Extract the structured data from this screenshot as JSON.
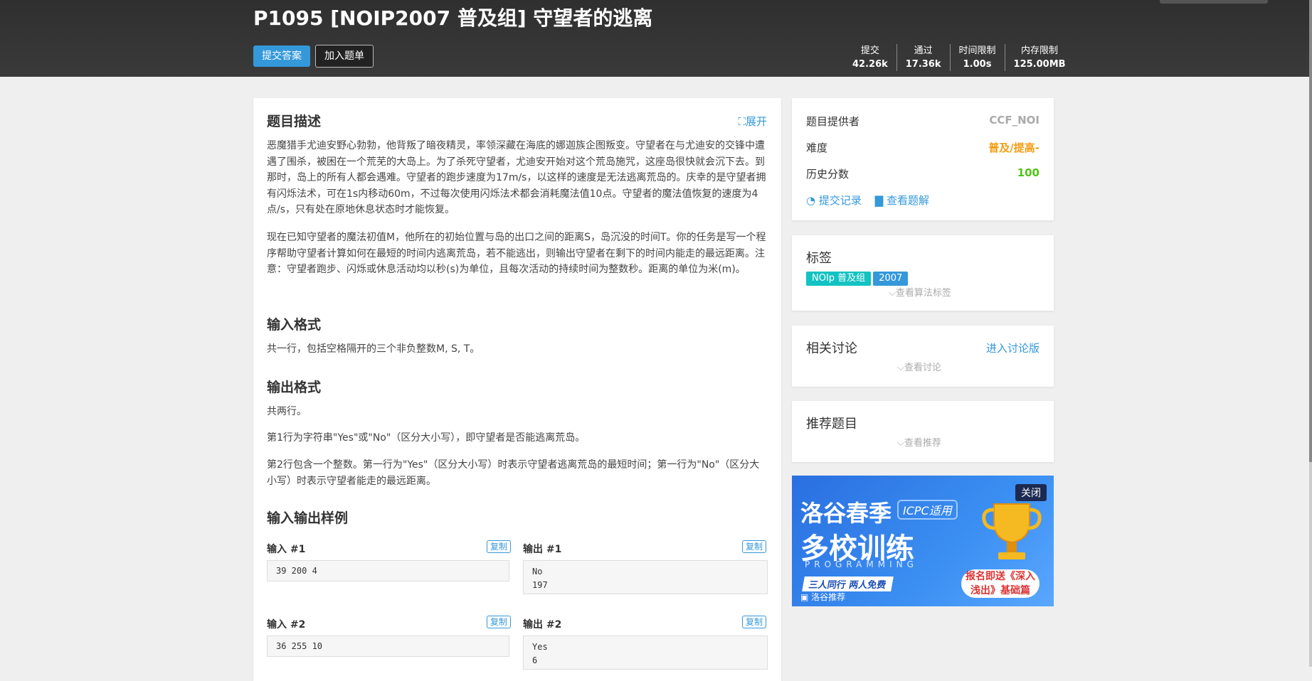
{
  "header": {
    "title": "P1095 [NOIP2007 普及组] 守望者的逃离",
    "submit_label": "提交答案",
    "add_label": "加入题单",
    "stats": [
      {
        "label": "提交",
        "value": "42.26k"
      },
      {
        "label": "通过",
        "value": "17.36k"
      },
      {
        "label": "时间限制",
        "value": "1.00s"
      },
      {
        "label": "内存限制",
        "value": "125.00MB"
      }
    ]
  },
  "problem": {
    "desc_title": "题目描述",
    "expand_label": "展开",
    "desc_p1": "恶魔猎手尤迪安野心勃勃，他背叛了暗夜精灵，率领深藏在海底的娜迦族企图叛变。守望者在与尤迪安的交锋中遭遇了围杀，被困在一个荒芜的大岛上。为了杀死守望者，尤迪安开始对这个荒岛施咒，这座岛很快就会沉下去。到那时，岛上的所有人都会遇难。守望者的跑步速度为17m/s，以这样的速度是无法逃离荒岛的。庆幸的是守望者拥有闪烁法术，可在1s内移动60m，不过每次使用闪烁法术都会消耗魔法值10点。守望者的魔法值恢复的速度为4点/s，只有处在原地休息状态时才能恢复。",
    "desc_p2": "现在已知守望者的魔法初值M，他所在的初始位置与岛的出口之间的距离S，岛沉没的时间T。你的任务是写一个程序帮助守望者计算如何在最短的时间内逃离荒岛，若不能逃出，则输出守望者在剩下的时间内能走的最远距离。注意：守望者跑步、闪烁或休息活动均以秒(s)为单位，且每次活动的持续时间为整数秒。距离的单位为米(m)。",
    "input_title": "输入格式",
    "input_text": "共一行，包括空格隔开的三个非负整数M, S, T。",
    "output_title": "输出格式",
    "output_p1": "共两行。",
    "output_p2": "第1行为字符串\"Yes\"或\"No\"（区分大小写），即守望者是否能逃离荒岛。",
    "output_p3": "第2行包含一个整数。第一行为\"Yes\"（区分大小写）时表示守望者逃离荒岛的最短时间；第一行为\"No\"（区分大小写）时表示守望者能走的最远距离。",
    "samples_title": "输入输出样例",
    "copy_label": "复制",
    "samples": [
      {
        "in_label": "输入 #1",
        "in": "39 200 4",
        "out_label": "输出 #1",
        "out": "No\n197"
      },
      {
        "in_label": "输入 #2",
        "in": "36 255 10",
        "out_label": "输出 #2",
        "out": "Yes\n6"
      }
    ]
  },
  "sidebar": {
    "provider_label": "题目提供者",
    "provider": "CCF_NOI",
    "difficulty_label": "难度",
    "difficulty": "普及/提高-",
    "score_label": "历史分数",
    "score": "100",
    "records_link": "提交记录",
    "solutions_link": "查看题解",
    "tags_title": "标签",
    "tags": [
      "NOIp 普及组",
      "2007"
    ],
    "show_algo_tags": "查看算法标签",
    "discuss_title": "相关讨论",
    "discuss_link": "进入讨论版",
    "show_discuss": "查看讨论",
    "recommend_title": "推荐题目",
    "show_recommend": "查看推荐"
  },
  "ad": {
    "line1": "洛谷春季",
    "line2": "多校训练",
    "icpc": "ICPC适用",
    "programming": "PROGRAMMING",
    "strip": "三人同行 两人免费",
    "bubble": "报名即送《深入浅出》基础篇",
    "close": "关闭",
    "recommend": "洛谷推荐"
  },
  "colors": {
    "accent": "#3498db",
    "difficulty": "#f39c11",
    "score": "#52c41a",
    "tag_noip": "#13c2c2",
    "tag_year": "#3498db"
  }
}
